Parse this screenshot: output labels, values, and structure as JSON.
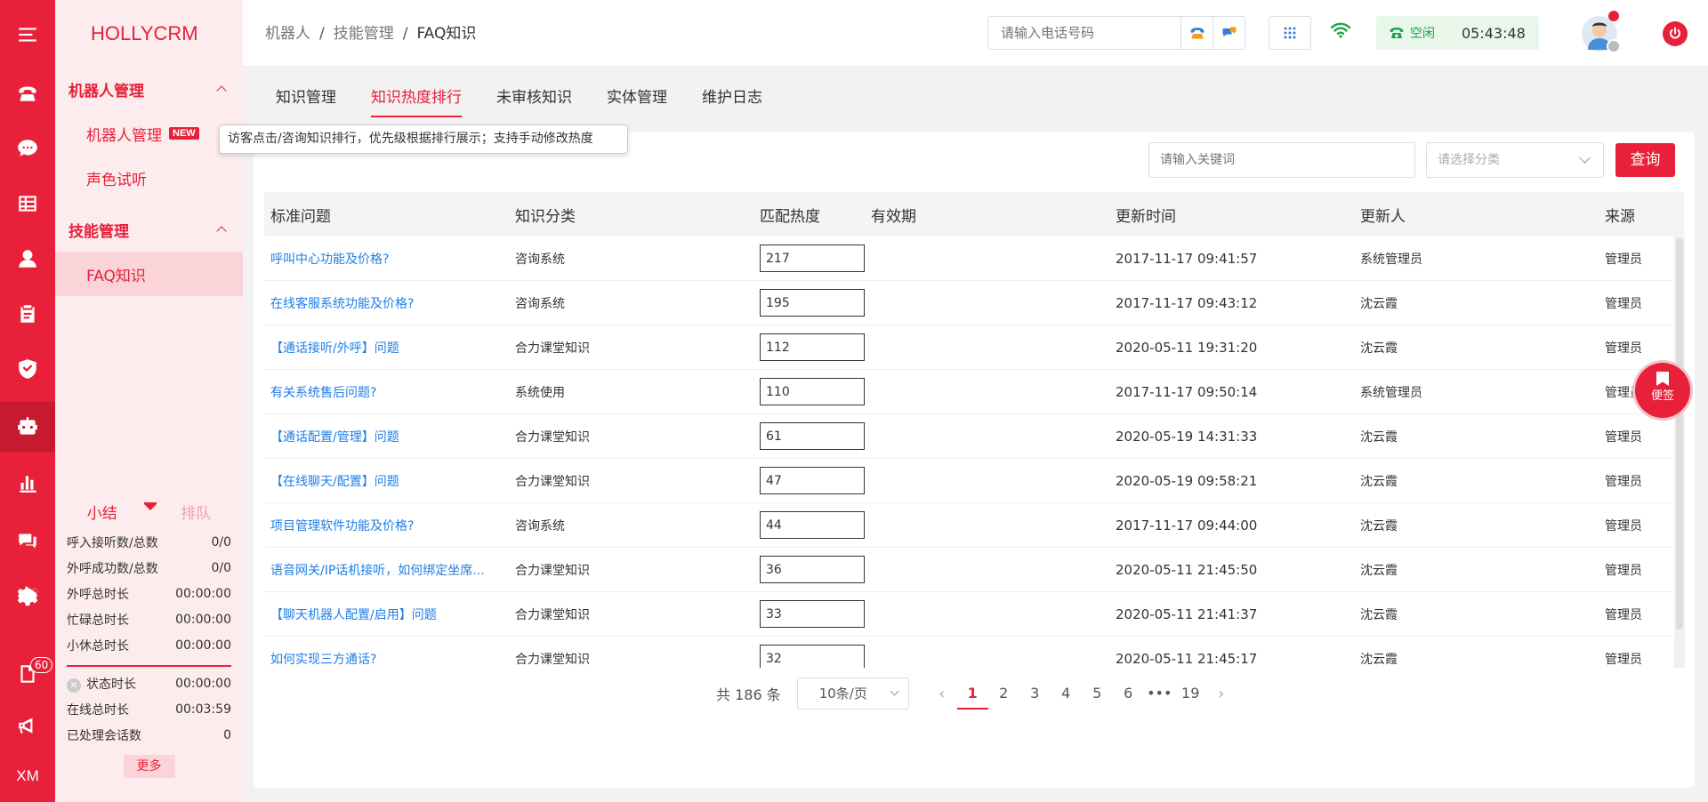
{
  "app": {
    "logo": "HOLLYCRM"
  },
  "rail": {
    "badge_count": "60",
    "bottom_label": "XM",
    "active_index": 7
  },
  "sidebar": {
    "groups": [
      {
        "label": "机器人管理",
        "items": [
          {
            "label": "机器人管理",
            "tag": "NEW"
          },
          {
            "label": "声色试听"
          }
        ]
      },
      {
        "label": "技能管理",
        "items": [
          {
            "label": "FAQ知识"
          }
        ]
      }
    ]
  },
  "stats": {
    "tab_summary": "小结",
    "tab_queue": "排队",
    "rows": [
      {
        "label": "呼入接听数/总数",
        "value": "0/0"
      },
      {
        "label": "外呼成功数/总数",
        "value": "0/0"
      },
      {
        "label": "外呼总时长",
        "value": "00:00:00"
      },
      {
        "label": "忙碌总时长",
        "value": "00:00:00"
      },
      {
        "label": "小休总时长",
        "value": "00:00:00"
      }
    ],
    "rows2": [
      {
        "label": "状态时长",
        "value": "00:00:00"
      },
      {
        "label": "在线总时长",
        "value": "00:03:59"
      },
      {
        "label": "已处理会话数",
        "value": "0"
      }
    ],
    "more": "更多"
  },
  "header": {
    "breadcrumb": [
      "机器人",
      "技能管理",
      "FAQ知识"
    ],
    "phone_placeholder": "请输入电话号码",
    "status_text": "空闲",
    "time": "05:43:48"
  },
  "tabs": [
    "知识管理",
    "知识热度排行",
    "未审核知识",
    "实体管理",
    "维护日志"
  ],
  "tooltip": "访客点击/咨询知识排行，优先级根据排行展示；支持手动修改热度",
  "search": {
    "keyword_placeholder": "请输入关键词",
    "category_placeholder": "请选择分类",
    "query_label": "查询"
  },
  "table": {
    "headers": [
      "标准问题",
      "知识分类",
      "匹配热度",
      "有效期",
      "更新时间",
      "更新人",
      "来源"
    ],
    "rows": [
      {
        "question": "呼叫中心功能及价格?",
        "category": "咨询系统",
        "heat": "217",
        "valid": "",
        "updated": "2017-11-17 09:41:57",
        "updater": "系统管理员",
        "source": "管理员"
      },
      {
        "question": "在线客服系统功能及价格?",
        "category": "咨询系统",
        "heat": "195",
        "valid": "",
        "updated": "2017-11-17 09:43:12",
        "updater": "沈云霞",
        "source": "管理员"
      },
      {
        "question": "【通话接听/外呼】问题",
        "category": "合力课堂知识",
        "heat": "112",
        "valid": "",
        "updated": "2020-05-11 19:31:20",
        "updater": "沈云霞",
        "source": "管理员"
      },
      {
        "question": "有关系统售后问题?",
        "category": "系统使用",
        "heat": "110",
        "valid": "",
        "updated": "2017-11-17 09:50:14",
        "updater": "系统管理员",
        "source": "管理员"
      },
      {
        "question": "【通话配置/管理】问题",
        "category": "合力课堂知识",
        "heat": "61",
        "valid": "",
        "updated": "2020-05-19 14:31:33",
        "updater": "沈云霞",
        "source": "管理员"
      },
      {
        "question": "【在线聊天/配置】问题",
        "category": "合力课堂知识",
        "heat": "47",
        "valid": "",
        "updated": "2020-05-19 09:58:21",
        "updater": "沈云霞",
        "source": "管理员"
      },
      {
        "question": "项目管理软件功能及价格?",
        "category": "咨询系统",
        "heat": "44",
        "valid": "",
        "updated": "2017-11-17 09:44:00",
        "updater": "沈云霞",
        "source": "管理员"
      },
      {
        "question": "语音网关/IP话机接听，如何绑定坐席...",
        "category": "合力课堂知识",
        "heat": "36",
        "valid": "",
        "updated": "2020-05-11 21:45:50",
        "updater": "沈云霞",
        "source": "管理员"
      },
      {
        "question": "【聊天机器人配置/启用】问题",
        "category": "合力课堂知识",
        "heat": "33",
        "valid": "",
        "updated": "2020-05-11 21:41:37",
        "updater": "沈云霞",
        "source": "管理员"
      },
      {
        "question": "如何实现三方通话?",
        "category": "合力课堂知识",
        "heat": "32",
        "valid": "",
        "updated": "2020-05-11 21:45:17",
        "updater": "沈云霞",
        "source": "管理员"
      }
    ]
  },
  "pagination": {
    "total": "共 186 条",
    "page_size": "10条/页",
    "pages": [
      "1",
      "2",
      "3",
      "4",
      "5",
      "6",
      "•••",
      "19"
    ],
    "current": "1"
  },
  "memo": {
    "label": "便签"
  },
  "colors": {
    "brand": "#e8203a",
    "link": "#1e7ee6",
    "status_green": "#1aa34a"
  }
}
